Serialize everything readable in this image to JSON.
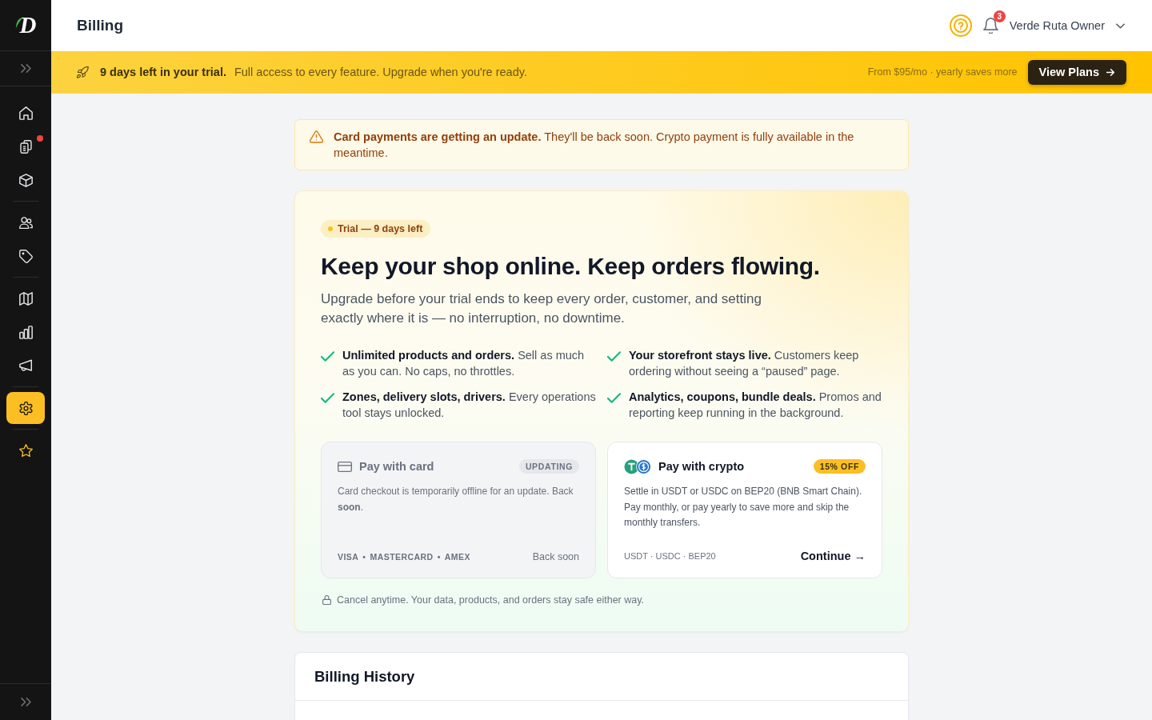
{
  "sidebar": {
    "logo": "D",
    "groups": [
      {
        "items": [
          {
            "selected": false,
            "alert": false
          },
          {
            "selected": false,
            "alert": true
          },
          {
            "selected": false,
            "alert": false
          }
        ]
      },
      {
        "items": [
          {
            "selected": false,
            "alert": false
          },
          {
            "selected": false,
            "alert": false
          }
        ]
      },
      {
        "items": [
          {
            "selected": false,
            "alert": false
          },
          {
            "selected": false,
            "alert": false
          },
          {
            "selected": false,
            "alert": false
          }
        ]
      },
      {
        "items": [
          {
            "selected": true,
            "alert": false
          }
        ]
      },
      {
        "items": [
          {
            "selected": false,
            "alert": false
          }
        ]
      }
    ]
  },
  "header": {
    "title": "Billing",
    "notification_count": "3",
    "user": "Verde Ruta Owner"
  },
  "trial_banner": {
    "title": "9 days left in your trial.",
    "message": "Full access to every feature. Upgrade when you're ready.",
    "pricing": "From $95/mo · yearly saves more",
    "button": "View Plans"
  },
  "notice": {
    "text": "**Card payments are getting an update.** They'll be back soon. Crypto payment is fully available in the meantime."
  },
  "hero": {
    "badge": "Trial — 9 days left",
    "title": "Keep your shop online. Keep orders flowing.",
    "subtitle": "Upgrade before your trial ends to keep every order, customer, and setting exactly where it is — no interruption, no downtime.",
    "features": [
      {
        "text": "**Unlimited products and orders.** Sell as much as you can. No caps, no throttles."
      },
      {
        "text": "**Your storefront stays live.** Customers keep ordering without seeing a “paused” page."
      },
      {
        "text": "**Zones, delivery slots, drivers.** Every operations tool stays unlocked."
      },
      {
        "text": "**Analytics, coupons, bundle deals.** Promos and reporting keep running in the background."
      }
    ],
    "payment_options": [
      {
        "kind": "card",
        "title": "Pay with card",
        "badge": "UPDATING",
        "disabled": true,
        "description": "Card checkout is temporarily offline for an update. Back **soon**.",
        "methods": "VISA • MASTERCARD • AMEX",
        "status": "Back soon"
      },
      {
        "kind": "crypto",
        "title": "Pay with crypto",
        "badge": "15% OFF",
        "disabled": false,
        "description": "Settle in USDT or USDC on BEP20 (BNB Smart Chain). Pay monthly, or pay yearly to save more and skip the monthly transfers.",
        "methods": "USDT · USDC · BEP20",
        "action": "Continue →"
      }
    ],
    "note": "Cancel anytime. Your data, products, and orders stay safe either way."
  },
  "billing_history": {
    "title": "Billing History"
  }
}
